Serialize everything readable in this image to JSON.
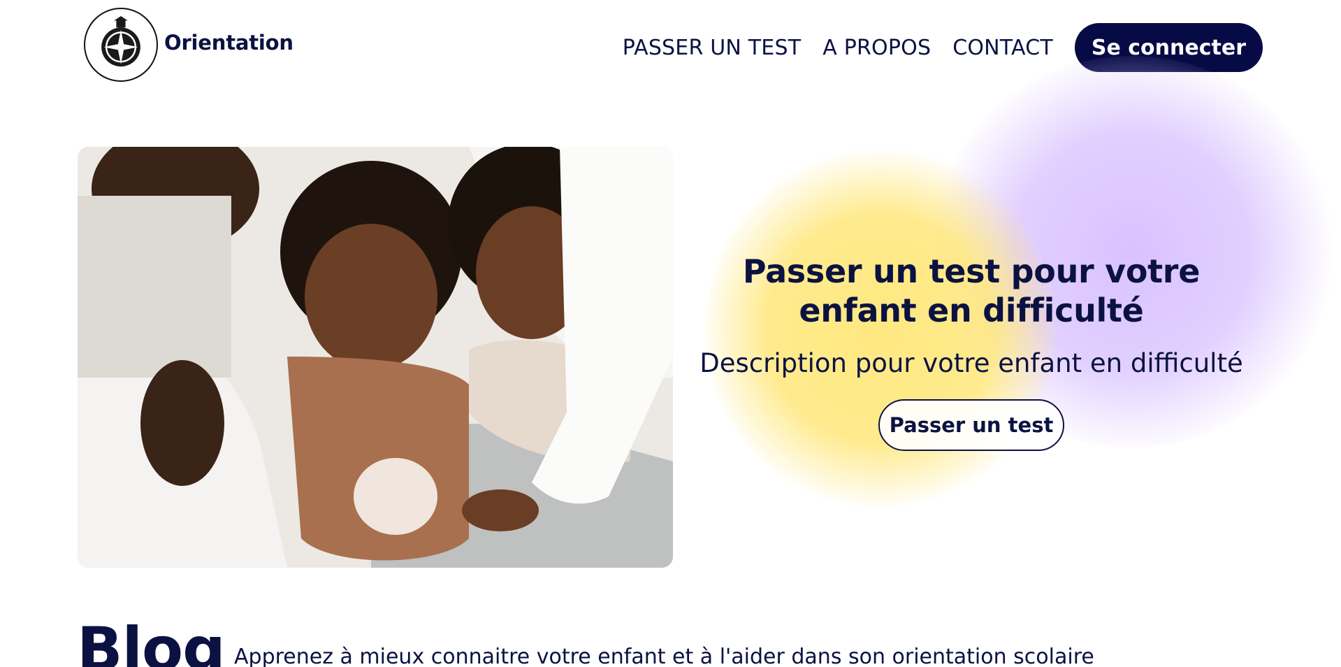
{
  "header": {
    "brand": "Orientation",
    "logo_icon": "compass-logo-icon",
    "nav": [
      {
        "label": "PASSER UN TEST"
      },
      {
        "label": "A PROPOS"
      },
      {
        "label": "CONTACT"
      }
    ],
    "login_label": "Se connecter"
  },
  "hero": {
    "image_subject": "family-photo",
    "title": "Passer un test pour votre enfant en difficulté",
    "description": "Description pour votre enfant en difficulté",
    "cta_label": "Passer un test"
  },
  "blog": {
    "title": "Blog",
    "subtitle": "Apprenez à mieux connaitre votre enfant et à l'aider dans son orientation scolaire"
  },
  "colors": {
    "navy": "#0b1242",
    "button_dark": "#060a45",
    "yellow_blob": "#ffe77a",
    "purple_blob": "#d7beff"
  }
}
